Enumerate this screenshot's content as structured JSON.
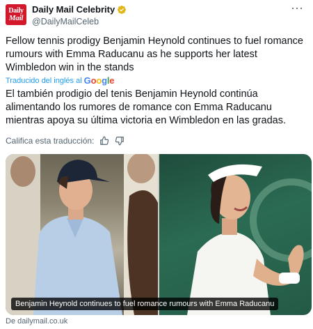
{
  "account": {
    "avatar_line1": "Daily",
    "avatar_line2": "Mail",
    "display_name": "Daily Mail Celebrity",
    "handle": "@DailyMailCeleb",
    "more_label": "···"
  },
  "tweet": {
    "text": "Fellow tennis prodigy Benjamin Heynold continues to fuel romance rumours with Emma Raducanu as he supports her latest Wimbledon win in the stands"
  },
  "translation": {
    "translated_by": "Traducido del inglés al",
    "google_letters": [
      "G",
      "o",
      "o",
      "g",
      "l",
      "e"
    ],
    "text": "El también prodigio del tenis Benjamin Heynold continúa alimentando los rumores de romance con Emma Raducanu mientras apoya su última victoria en Wimbledon en las gradas.",
    "rate_label": "Califica esta traducción:"
  },
  "media": {
    "caption": "Benjamin Heynold continues to fuel romance rumours with Emma Raducanu"
  },
  "link": {
    "source": "De dailymail.co.uk"
  },
  "colors": {
    "brand_red": "#d3182c",
    "verified_gold": "#e2b719",
    "link_blue": "#1d9bf0",
    "muted": "#536471"
  },
  "icons": {
    "verified": "verified-badge-icon",
    "thumbs_up": "thumbs-up-icon",
    "thumbs_down": "thumbs-down-icon",
    "more": "more-horizontal-icon"
  }
}
